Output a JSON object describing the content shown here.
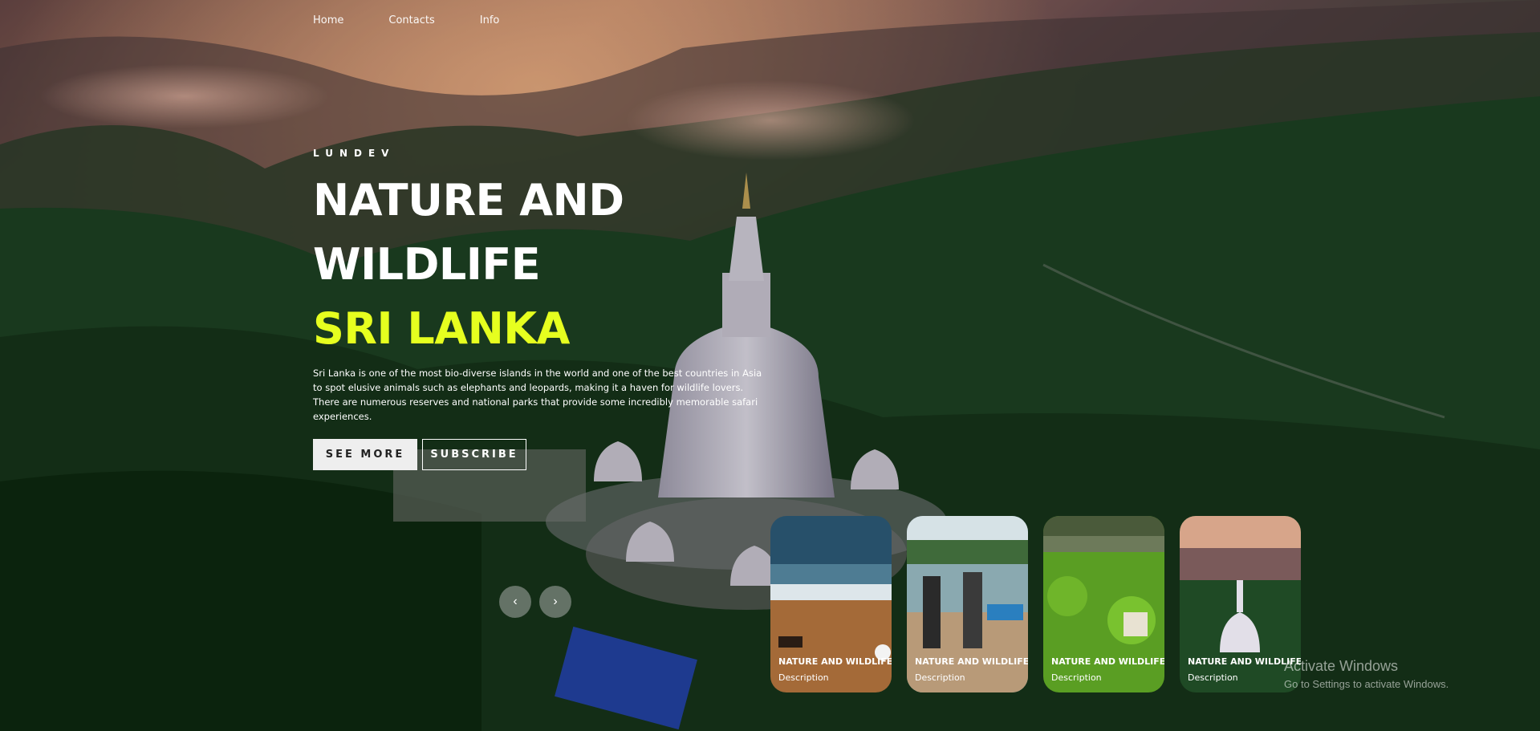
{
  "nav": {
    "items": [
      "Home",
      "Contacts",
      "Info"
    ]
  },
  "hero": {
    "brand": "LUNDEV",
    "title": "NATURE AND WILDLIFE",
    "subtitle": "SRI LANKA",
    "description": "Sri Lanka is one of the most bio-diverse islands in the world and one of the best countries in Asia to spot elusive animals such as elephants and leopards, making it a haven for wildlife lovers. There are numerous reserves and national parks that provide some incredibly memorable safari experiences.",
    "see_more_label": "SEE MORE",
    "subscribe_label": "SUBSCRIBE",
    "accent_color": "#e6ff1f"
  },
  "slider": {
    "prev_icon": "‹",
    "next_icon": "›"
  },
  "cards": [
    {
      "title": "NATURE AND WILDLIFE",
      "description": "Description"
    },
    {
      "title": "NATURE AND WILDLIFE",
      "description": "Description"
    },
    {
      "title": "NATURE AND WILDLIFE",
      "description": "Description"
    },
    {
      "title": "NATURE AND WILDLIFE",
      "description": "Description"
    }
  ],
  "windows_watermark": {
    "line1": "Activate Windows",
    "line2": "Go to Settings to activate Windows."
  }
}
